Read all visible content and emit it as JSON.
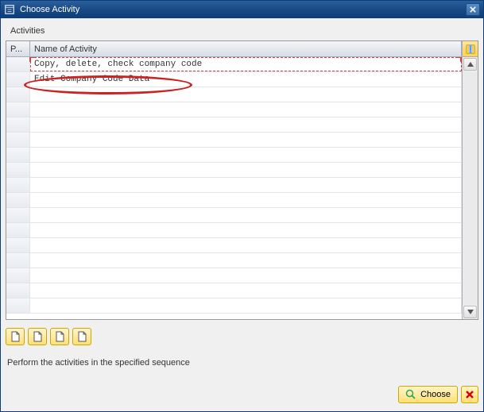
{
  "window": {
    "title": "Choose Activity"
  },
  "section": {
    "label": "Activities"
  },
  "grid": {
    "headers": {
      "performed": "P...",
      "name": "Name of Activity"
    },
    "rows": [
      {
        "name": "Copy, delete, check company code"
      },
      {
        "name": "Edit Company Code Data"
      }
    ]
  },
  "instruction": "Perform the activities in the specified sequence",
  "footer": {
    "choose_label": "Choose"
  }
}
